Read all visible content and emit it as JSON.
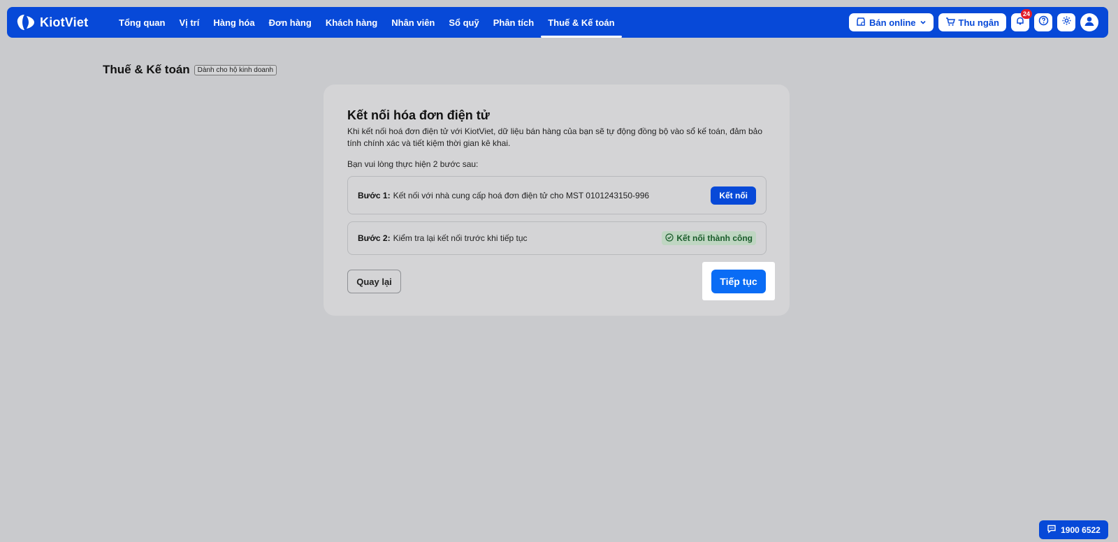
{
  "app": {
    "name": "KiotViet"
  },
  "nav": {
    "items": [
      {
        "label": "Tổng quan"
      },
      {
        "label": "Vị trí"
      },
      {
        "label": "Hàng hóa"
      },
      {
        "label": "Đơn hàng"
      },
      {
        "label": "Khách hàng"
      },
      {
        "label": "Nhân viên"
      },
      {
        "label": "Sổ quỹ"
      },
      {
        "label": "Phân tích"
      },
      {
        "label": "Thuế & Kế toán",
        "active": true
      }
    ]
  },
  "toolbar": {
    "sell_online_label": "Bán online",
    "cashier_label": "Thu ngân",
    "notification_count": "24"
  },
  "page": {
    "title": "Thuế & Kế toán",
    "tag": "Dành cho hộ kinh doanh"
  },
  "card": {
    "title": "Kết nối hóa đơn điện tử",
    "description": "Khi kết nối hoá đơn điện tử với KiotViet, dữ liệu bán hàng của bạn sẽ tự động đồng bộ vào sổ kế toán, đảm bảo tính chính xác và tiết kiệm thời gian kê khai.",
    "subtitle": "Bạn vui lòng thực hiện 2 bước sau:",
    "step1": {
      "label": "Bước 1:",
      "text": "Kết nối với nhà cung cấp hoá đơn điện tử cho MST 0101243150-996",
      "button": "Kết nối"
    },
    "step2": {
      "label": "Bước 2:",
      "text": "Kiểm tra lại kết nối trước khi tiếp tục",
      "status": "Kết nối thành công"
    },
    "back_label": "Quay lại",
    "continue_label": "Tiếp tục"
  },
  "hotline": {
    "number": "1900 6522"
  },
  "colors": {
    "brand": "#0749d8",
    "primary_button": "#0a6cf5",
    "success_bg": "#bfd6c2",
    "success_text": "#1a5c2b",
    "badge": "#e11d2a"
  }
}
